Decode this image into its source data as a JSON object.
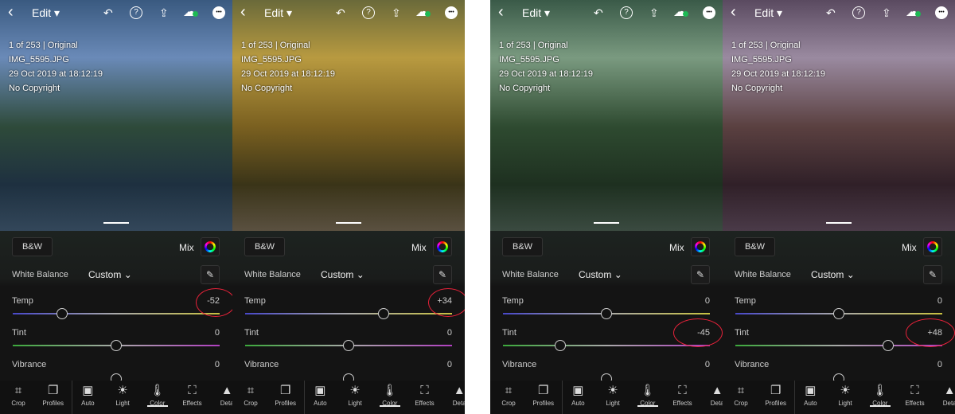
{
  "topbar": {
    "title": "Edit",
    "back_icon": "chevron-left-icon",
    "undo_icon": "undo-icon",
    "help_icon": "help-icon",
    "share_icon": "share-icon",
    "cloud_icon": "cloud-sync-icon",
    "more_icon": "more-icon"
  },
  "meta": {
    "counter": "1 of 253 | Original",
    "filename": "IMG_5595.JPG",
    "date": "29 Oct 2019 at 18:12:19",
    "copyright": "No Copyright"
  },
  "controls": {
    "bw": "B&W",
    "mix": "Mix",
    "white_balance": "White Balance",
    "wb_value": "Custom",
    "temp": "Temp",
    "tint": "Tint",
    "vibrance": "Vibrance"
  },
  "toolbar": [
    {
      "label": "Crop",
      "icon": "crop-icon"
    },
    {
      "label": "Profiles",
      "icon": "profiles-icon"
    },
    {
      "label": "Auto",
      "icon": "auto-icon"
    },
    {
      "label": "Light",
      "icon": "light-icon"
    },
    {
      "label": "Color",
      "icon": "color-icon",
      "active": true
    },
    {
      "label": "Effects",
      "icon": "effects-icon"
    },
    {
      "label": "Deta",
      "icon": "detail-icon"
    }
  ],
  "panels": [
    {
      "tone": "blue",
      "temp": "-52",
      "temp_value": -52,
      "tint": "0",
      "tint_value": 0,
      "vibrance": "0",
      "highlight": "temp"
    },
    {
      "tone": "warm",
      "temp": "+34",
      "temp_value": 34,
      "tint": "0",
      "tint_value": 0,
      "vibrance": "0",
      "highlight": "temp"
    },
    {
      "tone": "green",
      "temp": "0",
      "temp_value": 0,
      "tint": "-45",
      "tint_value": -45,
      "vibrance": "0",
      "highlight": "tint"
    },
    {
      "tone": "magenta",
      "temp": "0",
      "temp_value": 0,
      "tint": "+48",
      "tint_value": 48,
      "vibrance": "0",
      "highlight": "tint"
    }
  ],
  "colors": {
    "annotation": "#e8223a",
    "temp_track": [
      "#4848c8",
      "#c8c040"
    ],
    "tint_track": [
      "#3ca83c",
      "#b040c0"
    ]
  }
}
